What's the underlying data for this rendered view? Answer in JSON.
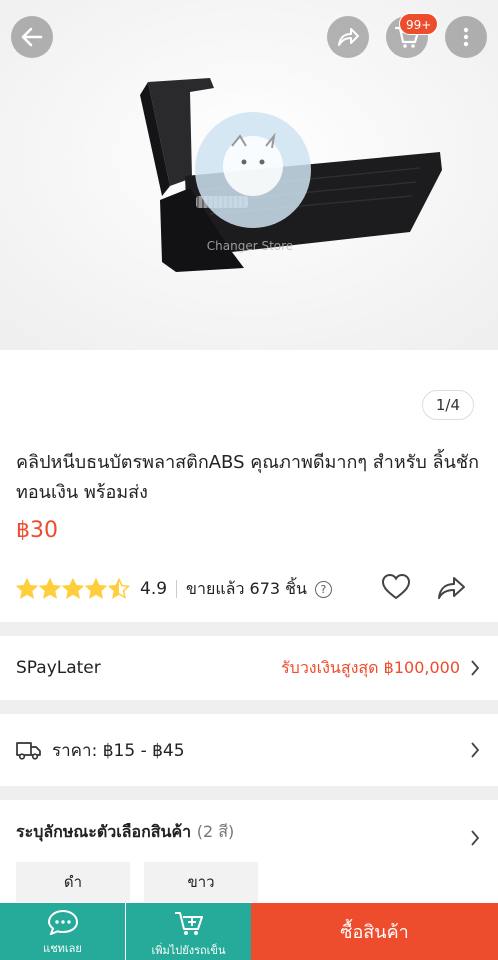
{
  "header": {
    "cart_badge": "99+",
    "icons": [
      "back-arrow-icon",
      "share-icon",
      "cart-icon",
      "more-vertical-icon"
    ]
  },
  "gallery": {
    "counter": "1/4",
    "watermark": "Changer Store"
  },
  "product": {
    "title": "คลิปหนีบธนบัตรพลาสติกABS คุณภาพดีมากๆ สำหรับ ลิ้นชักทอนเงิน พร้อมส่ง",
    "price": "฿30",
    "rating": "4.9",
    "rating_stars": 4.5,
    "sold": "ขายแล้ว 673 ชิ้น"
  },
  "spaylater": {
    "label": "SPayLater",
    "promo": "รับวงเงินสูงสุด ฿100,000"
  },
  "shipping": {
    "label": "ราคา: ฿15 - ฿45"
  },
  "variants": {
    "title": "ระบุลักษณะตัวเลือกสินค้า",
    "count": "(2 สี)",
    "options": [
      "ดำ",
      "ขาว"
    ]
  },
  "bottom_bar": {
    "chat_label": "แชทเลย",
    "cart_label": "เพิ่มไปยังรถเข็น",
    "buy_label": "ซื้อสินค้า"
  },
  "colors": {
    "accent": "#ee4d2d",
    "teal": "#26aa99",
    "star": "#ffce3d"
  }
}
